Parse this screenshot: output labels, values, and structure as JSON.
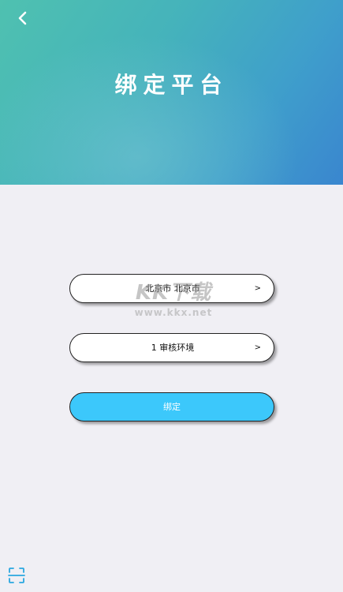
{
  "header": {
    "back_icon": "chevron-left-icon",
    "title": "绑定平台"
  },
  "form": {
    "region": {
      "value": "北京市 北京市",
      "arrow": ">"
    },
    "environment": {
      "value": "1 审核环境",
      "arrow": ">"
    },
    "bind_label": "绑定"
  },
  "watermark": {
    "logo": "KK下载",
    "url": "www.kkx.net"
  },
  "footer": {
    "scan_icon": "scan-icon"
  },
  "colors": {
    "header_start": "#4fc1b0",
    "header_end": "#3a86cf",
    "background": "#f0eff4",
    "button": "#3cc8fb"
  }
}
